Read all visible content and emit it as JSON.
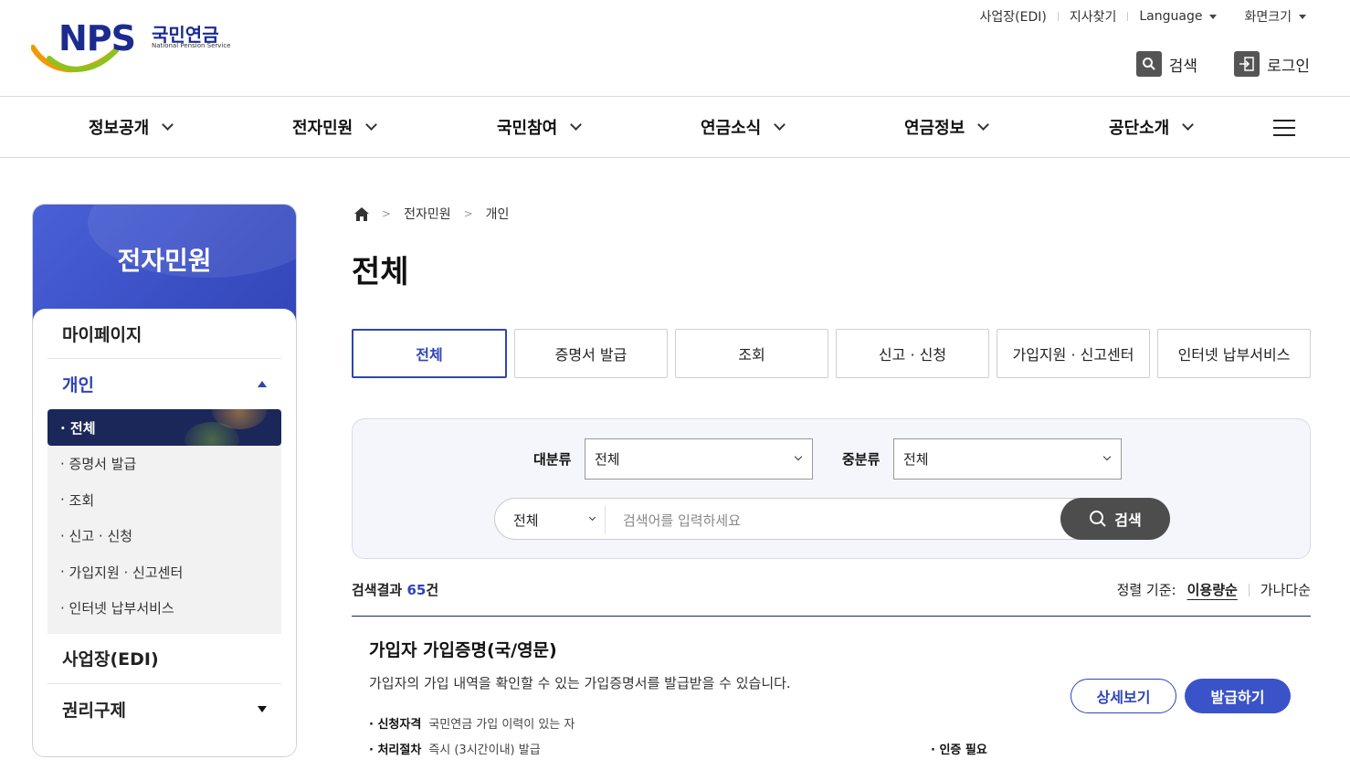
{
  "header": {
    "logo_text": "NPS",
    "logo_kor": "국민연금",
    "logo_eng": "National Pension Service",
    "util_links": [
      "사업장(EDI)",
      "지사찾기",
      "Language",
      "화면크기"
    ],
    "search_label": "검색",
    "login_label": "로그인"
  },
  "gnb": [
    "정보공개",
    "전자민원",
    "국민참여",
    "연금소식",
    "연금정보",
    "공단소개"
  ],
  "sidebar": {
    "title": "전자민원",
    "mypage": "마이페이지",
    "personal": "개인",
    "sub_items": [
      "전체",
      "증명서 발급",
      "조회",
      "신고 · 신청",
      "가입지원 · 신고센터",
      "인터넷 납부서비스"
    ],
    "edi": "사업장(EDI)",
    "rights": "권리구제"
  },
  "breadcrumb": {
    "l1": "전자민원",
    "l2": "개인"
  },
  "page_title": "전체",
  "tabs": [
    "전체",
    "증명서 발급",
    "조회",
    "신고 · 신청",
    "가입지원 · 신고센터",
    "인터넷 납부서비스"
  ],
  "search": {
    "major_label": "대분류",
    "major_value": "전체",
    "minor_label": "중분류",
    "minor_value": "전체",
    "scope_value": "전체",
    "placeholder": "검색어를 입력하세요",
    "button": "검색"
  },
  "results": {
    "prefix": "검색결과 ",
    "count": "65",
    "suffix": "건",
    "sort_label": "정렬 기준:",
    "sort_current": "이용량순",
    "sort_other": "가나다순"
  },
  "item": {
    "title": "가입자 가입증명(국/영문)",
    "desc": "가입자의 가입 내역을 확인할 수 있는 가입증명서를 발급받을 수 있습니다.",
    "eligibility_label": "신청자격",
    "eligibility": "국민연금 가입 이력이 있는 자",
    "process_label": "처리절차",
    "process": "즉시 (3시간이내) 발급",
    "auth": "인증 필요",
    "detail_btn": "상세보기",
    "issue_btn": "발급하기"
  },
  "colors": {
    "primary": "#2f45b5",
    "navy": "#1c2759",
    "accent_orange": "#f39800",
    "accent_green": "#8dc21f"
  }
}
